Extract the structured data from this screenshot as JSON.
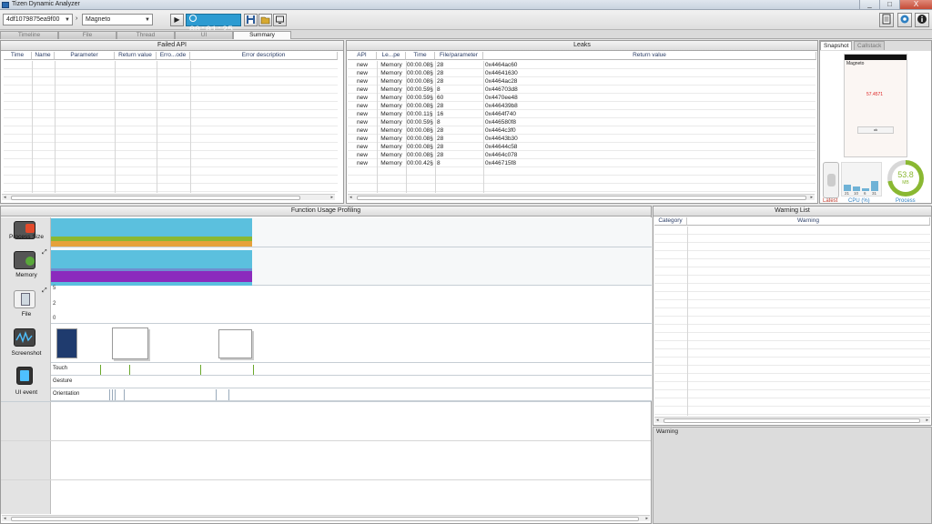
{
  "window": {
    "title": "Tizen Dynamic Analyzer",
    "min": "_",
    "max": "□",
    "close": "X"
  },
  "toolbar": {
    "device": "4df1079875ea9f00",
    "app": "Magneto",
    "timer": "00:01:25",
    "play_icon": "▶",
    "save_icon": "save-icon",
    "open_icon": "folder-icon",
    "replay_icon": "replay-icon"
  },
  "tabs": [
    "Timeline",
    "File",
    "Thread",
    "UI",
    "Summary"
  ],
  "active_tab": "Summary",
  "failed_api": {
    "title": "Failed API",
    "columns": [
      "Time",
      "Name",
      "Parameter",
      "Return value",
      "Erro...ode",
      "Error description"
    ]
  },
  "leaks": {
    "title": "Leaks",
    "columns": [
      "API",
      "Le...pe",
      "Time",
      "File/parameter",
      "Return value"
    ],
    "rows": [
      [
        "new",
        "Memory",
        "00:00.08§",
        "28",
        "0x4464ac60"
      ],
      [
        "new",
        "Memory",
        "00:00.08§",
        "28",
        "0x44641630"
      ],
      [
        "new",
        "Memory",
        "00:00.08§",
        "28",
        "0x4464ac28"
      ],
      [
        "new",
        "Memory",
        "00:00.59§",
        "8",
        "0x446703d8"
      ],
      [
        "new",
        "Memory",
        "00:00.59§",
        "60",
        "0x4470ee48"
      ],
      [
        "new",
        "Memory",
        "00:00.08§",
        "28",
        "0x446439b8"
      ],
      [
        "new",
        "Memory",
        "00:00.11§",
        "16",
        "0x4464f740"
      ],
      [
        "new",
        "Memory",
        "00:00.59§",
        "8",
        "0x446580f8"
      ],
      [
        "new",
        "Memory",
        "00:00.08§",
        "28",
        "0x4464c3f0"
      ],
      [
        "new",
        "Memory",
        "00:00.08§",
        "28",
        "0x44643b30"
      ],
      [
        "new",
        "Memory",
        "00:00.08§",
        "28",
        "0x44644c58"
      ],
      [
        "new",
        "Memory",
        "00:00.08§",
        "28",
        "0x4464c078"
      ],
      [
        "new",
        "Memory",
        "00:00.42§",
        "8",
        "0x446715f8"
      ]
    ]
  },
  "snapshot": {
    "tabs": [
      "Snapshot",
      "Callstack"
    ],
    "phone_title": "Magneto",
    "phone_value": "57.4571",
    "phone_button": "ok",
    "cpu_values": [
      "21",
      "10",
      "6",
      "31"
    ],
    "cpu_label": "CPU (%)",
    "latest_label": "Latest",
    "process_label": "Process",
    "process_value": "53.8",
    "process_unit": "MB"
  },
  "profiling": {
    "title": "Function Usage Profiling",
    "rows": [
      "Process Size",
      "Memory",
      "File",
      "Screenshot",
      "UI event"
    ],
    "file_ticks": [
      "5",
      "2",
      "0"
    ],
    "ui_lanes": [
      "Touch",
      "Gesture",
      "Orientation"
    ]
  },
  "warning": {
    "title": "Warning List",
    "columns": [
      "Category",
      "Warning"
    ],
    "detail_label": "Warning"
  },
  "colors": {
    "accent": "#2d9bd1",
    "process_green": "#8ab832",
    "memory_purple": "#8b2bbd",
    "lane_blue": "#5bc0de"
  }
}
